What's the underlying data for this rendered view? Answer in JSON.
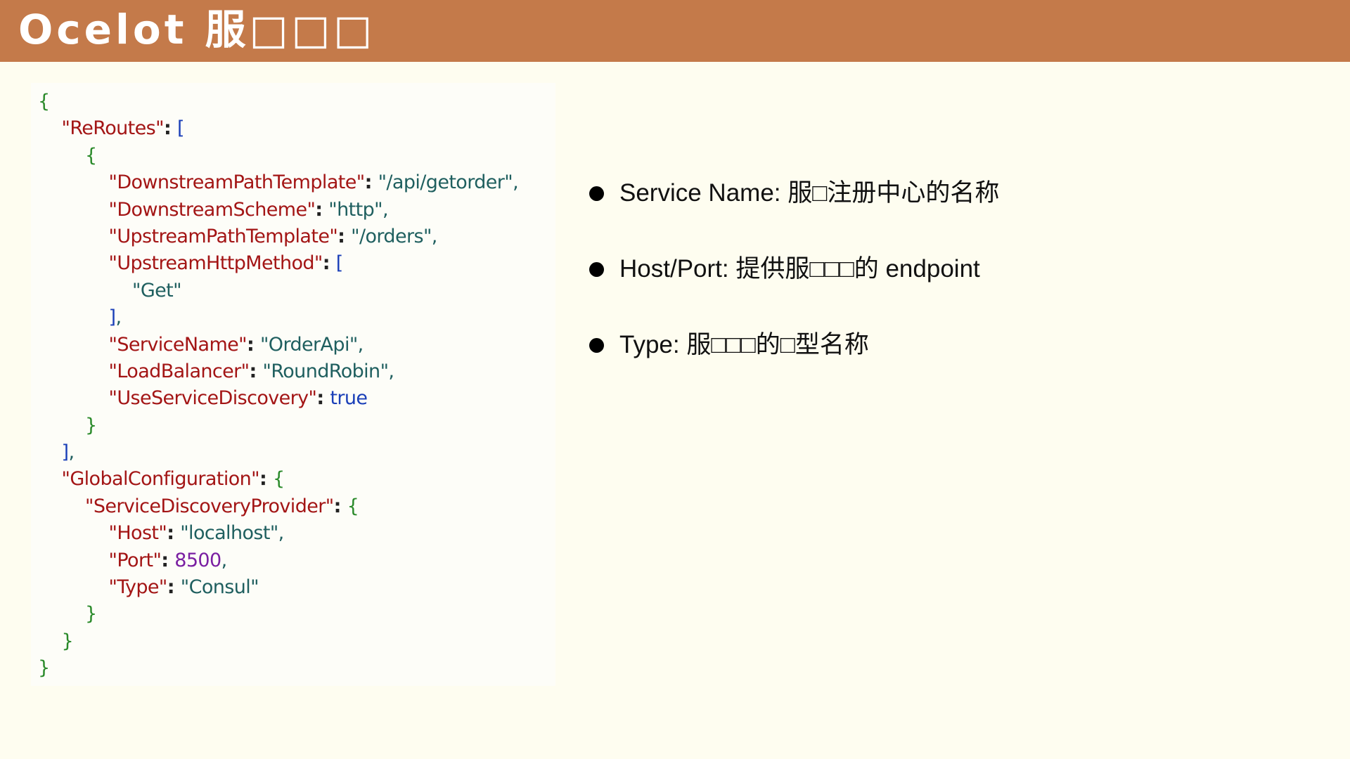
{
  "header": {
    "title": "Ocelot 服□□□",
    "background": "#c47a4a"
  },
  "code": {
    "lines": [
      {
        "indent": 0,
        "parts": [
          {
            "t": "br",
            "v": "{"
          }
        ]
      },
      {
        "indent": 1,
        "parts": [
          {
            "t": "k",
            "v": "\"ReRoutes\""
          },
          {
            "t": "p",
            "v": ": "
          },
          {
            "t": "bk",
            "v": "["
          }
        ]
      },
      {
        "indent": 2,
        "parts": [
          {
            "t": "br",
            "v": "{"
          }
        ]
      },
      {
        "indent": 3,
        "parts": [
          {
            "t": "k",
            "v": "\"DownstreamPathTemplate\""
          },
          {
            "t": "p",
            "v": ": "
          },
          {
            "t": "s",
            "v": "\"/api/getorder\","
          }
        ]
      },
      {
        "indent": 3,
        "parts": [
          {
            "t": "k",
            "v": "\"DownstreamScheme\""
          },
          {
            "t": "p",
            "v": ": "
          },
          {
            "t": "s",
            "v": "\"http\","
          }
        ]
      },
      {
        "indent": 3,
        "parts": [
          {
            "t": "k",
            "v": "\"UpstreamPathTemplate\""
          },
          {
            "t": "p",
            "v": ": "
          },
          {
            "t": "s",
            "v": "\"/orders\","
          }
        ]
      },
      {
        "indent": 3,
        "parts": [
          {
            "t": "k",
            "v": "\"UpstreamHttpMethod\""
          },
          {
            "t": "p",
            "v": ": "
          },
          {
            "t": "bk",
            "v": "["
          }
        ]
      },
      {
        "indent": 4,
        "parts": [
          {
            "t": "s",
            "v": "\"Get\""
          }
        ]
      },
      {
        "indent": 3,
        "parts": [
          {
            "t": "bk",
            "v": "]"
          },
          {
            "t": "s",
            "v": ","
          }
        ]
      },
      {
        "indent": 3,
        "parts": [
          {
            "t": "k",
            "v": "\"ServiceName\""
          },
          {
            "t": "p",
            "v": ": "
          },
          {
            "t": "s",
            "v": "\"OrderApi\","
          }
        ]
      },
      {
        "indent": 3,
        "parts": [
          {
            "t": "k",
            "v": "\"LoadBalancer\""
          },
          {
            "t": "p",
            "v": ": "
          },
          {
            "t": "s",
            "v": "\"RoundRobin\","
          }
        ]
      },
      {
        "indent": 3,
        "parts": [
          {
            "t": "k",
            "v": "\"UseServiceDiscovery\""
          },
          {
            "t": "p",
            "v": ": "
          },
          {
            "t": "bk",
            "v": "true"
          }
        ]
      },
      {
        "indent": 2,
        "parts": [
          {
            "t": "br",
            "v": "}"
          }
        ]
      },
      {
        "indent": 1,
        "parts": [
          {
            "t": "bk",
            "v": "]"
          },
          {
            "t": "s",
            "v": ","
          }
        ]
      },
      {
        "indent": 1,
        "parts": [
          {
            "t": "k",
            "v": "\"GlobalConfiguration\""
          },
          {
            "t": "p",
            "v": ": "
          },
          {
            "t": "br",
            "v": "{"
          }
        ]
      },
      {
        "indent": 2,
        "parts": [
          {
            "t": "k",
            "v": "\"ServiceDiscoveryProvider\""
          },
          {
            "t": "p",
            "v": ": "
          },
          {
            "t": "br",
            "v": "{"
          }
        ]
      },
      {
        "indent": 3,
        "parts": [
          {
            "t": "k",
            "v": "\"Host\""
          },
          {
            "t": "p",
            "v": ": "
          },
          {
            "t": "s",
            "v": "\"localhost\","
          }
        ]
      },
      {
        "indent": 3,
        "parts": [
          {
            "t": "k",
            "v": "\"Port\""
          },
          {
            "t": "p",
            "v": ": "
          },
          {
            "t": "n",
            "v": "8500"
          },
          {
            "t": "s",
            "v": ","
          }
        ]
      },
      {
        "indent": 3,
        "parts": [
          {
            "t": "k",
            "v": "\"Type\""
          },
          {
            "t": "p",
            "v": ": "
          },
          {
            "t": "s",
            "v": "\"Consul\""
          }
        ]
      },
      {
        "indent": 2,
        "parts": [
          {
            "t": "br",
            "v": "}"
          }
        ]
      },
      {
        "indent": 1,
        "parts": [
          {
            "t": "br",
            "v": "}"
          }
        ]
      },
      {
        "indent": 0,
        "parts": [
          {
            "t": "br",
            "v": "}"
          }
        ]
      }
    ]
  },
  "bullets": [
    {
      "text": "Service Name: 服□注册中心的名称"
    },
    {
      "text": "Host/Port: 提供服□□□的 endpoint"
    },
    {
      "text": "Type: 服□□□的□型名称"
    }
  ],
  "colors": {
    "key": "#a31515",
    "string": "#1f5f5f",
    "number": "#7a1fa2",
    "brace": "#2a8a2a",
    "bracket": "#1a3fb8"
  }
}
